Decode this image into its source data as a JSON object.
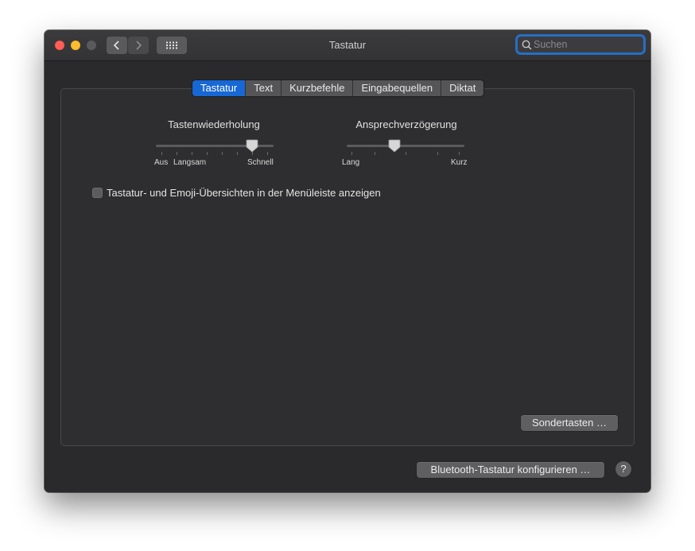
{
  "window": {
    "title": "Tastatur"
  },
  "toolbar": {
    "back_icon": "chevron-left-icon",
    "forward_icon": "chevron-right-icon",
    "show_all_icon": "grid-icon"
  },
  "search": {
    "placeholder": "Suchen"
  },
  "tabs": [
    {
      "label": "Tastatur",
      "active": true
    },
    {
      "label": "Text",
      "active": false
    },
    {
      "label": "Kurzbefehle",
      "active": false
    },
    {
      "label": "Eingabequellen",
      "active": false
    },
    {
      "label": "Diktat",
      "active": false
    }
  ],
  "key_repeat": {
    "title": "Tastenwiederholung",
    "label_off": "Aus",
    "label_slow": "Langsam",
    "label_fast": "Schnell",
    "value_fraction": 0.86
  },
  "delay_until_repeat": {
    "title": "Ansprechverzögerung",
    "label_long": "Lang",
    "label_short": "Kurz",
    "value_fraction": 0.4
  },
  "menu_bar_option": {
    "label": "Tastatur- und Emoji-Übersichten in der Menüleiste anzeigen",
    "checked": false
  },
  "buttons": {
    "modifier_keys": "Sondertasten …",
    "bluetooth": "Bluetooth-Tastatur konfigurieren …",
    "help": "?"
  },
  "colors": {
    "accent": "#1767d4",
    "close": "#ff5f57",
    "minimize": "#febc2e"
  }
}
